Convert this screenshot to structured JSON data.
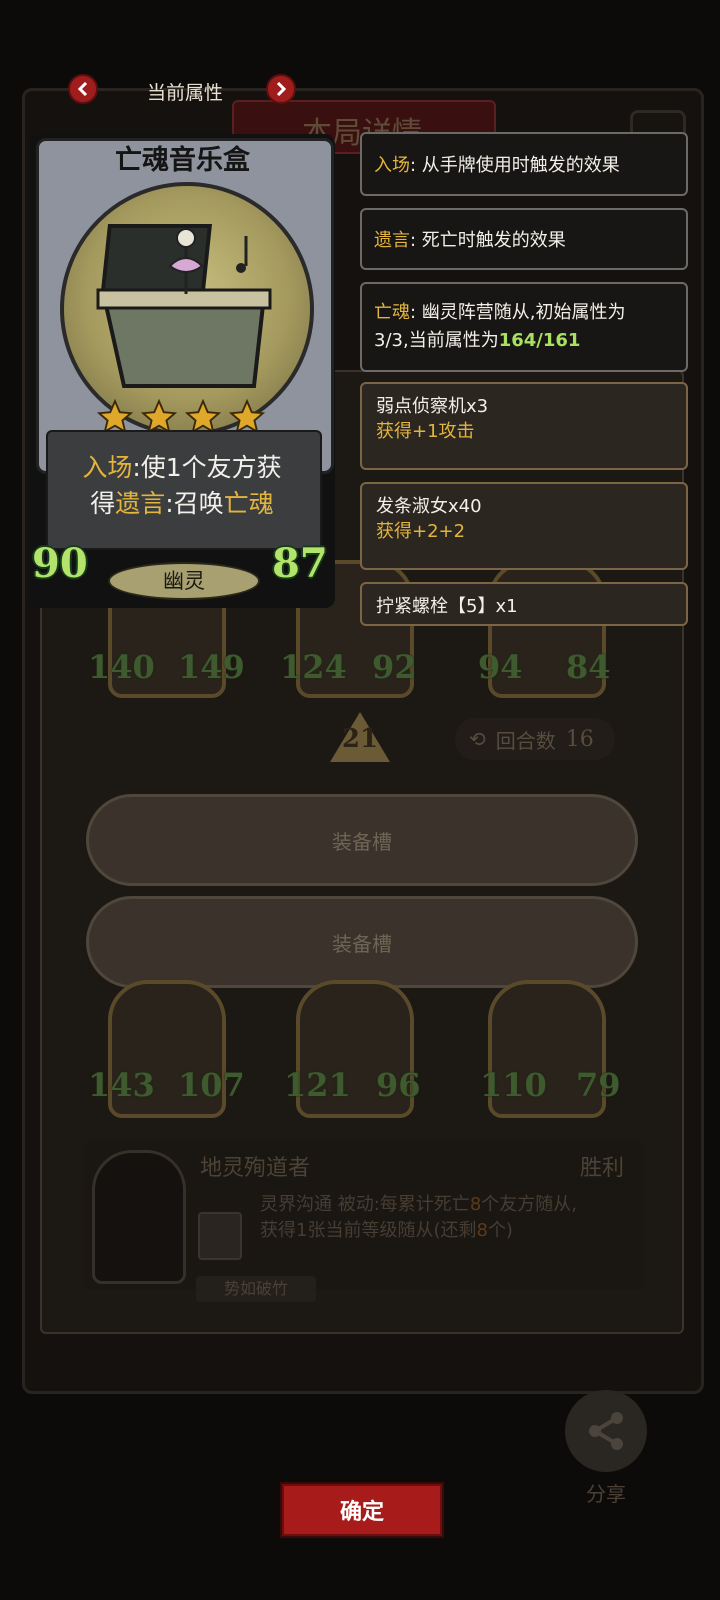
{
  "background": {
    "title": "本局详情",
    "row1": [
      {
        "atk": "140",
        "hp": "149"
      },
      {
        "atk": "124",
        "hp": "92"
      },
      {
        "atk": "94",
        "hp": "84"
      }
    ],
    "round_number": "21",
    "turns_label": "回合数",
    "turns_value": "16",
    "row2": [
      {
        "atk": "143",
        "hp": "107"
      },
      {
        "atk": "121",
        "hp": "96"
      },
      {
        "atk": "110",
        "hp": "79"
      }
    ],
    "equip_slots": [
      "装备槽",
      "装备槽"
    ],
    "boss": {
      "name": "地灵殉道者",
      "result": "胜利",
      "skill_name": "灵界沟通",
      "skill_type": "被动",
      "skill_desc_1": ":每累计死亡",
      "skill_count": "8",
      "skill_desc_2": "个友方随从,",
      "skill_desc_3": "获得1张当前等级随从(还剩",
      "skill_remaining": "8",
      "skill_desc_4": "个)",
      "tag": "势如破竹"
    },
    "share_label": "分享"
  },
  "popup": {
    "nav_title": "当前属性",
    "card": {
      "name": "亡魂音乐盒",
      "stars": 4,
      "desc_1": "入场",
      "desc_2": ":使1个友方获",
      "desc_3": "得",
      "desc_4": "遗言",
      "desc_5": ":召唤",
      "desc_6": "亡魂",
      "attack": "90",
      "health": "87",
      "tribe": "幽灵"
    },
    "info": [
      {
        "key": "入场",
        "text": ": 从手牌使用时触发的效果"
      },
      {
        "key": "遗言",
        "text": ": 死亡时触发的效果"
      }
    ],
    "ghost_info": {
      "key": "亡魂",
      "text_1": ": 幽灵阵营随从,初始属性为",
      "text_2": "3/3,当前属性为",
      "current": "164/161"
    },
    "buffs": [
      {
        "name": "弱点侦察机x3",
        "effect": "获得+1攻击"
      },
      {
        "name": "发条淑女x40",
        "effect": "获得+2+2"
      },
      {
        "name": "拧紧螺栓【5】x1",
        "effect": ""
      }
    ]
  },
  "confirm_label": "确定",
  "colors": {
    "accent_gold": "#e3b53d",
    "stat_green": "#a8e060",
    "confirm_red": "#a81b1b"
  }
}
